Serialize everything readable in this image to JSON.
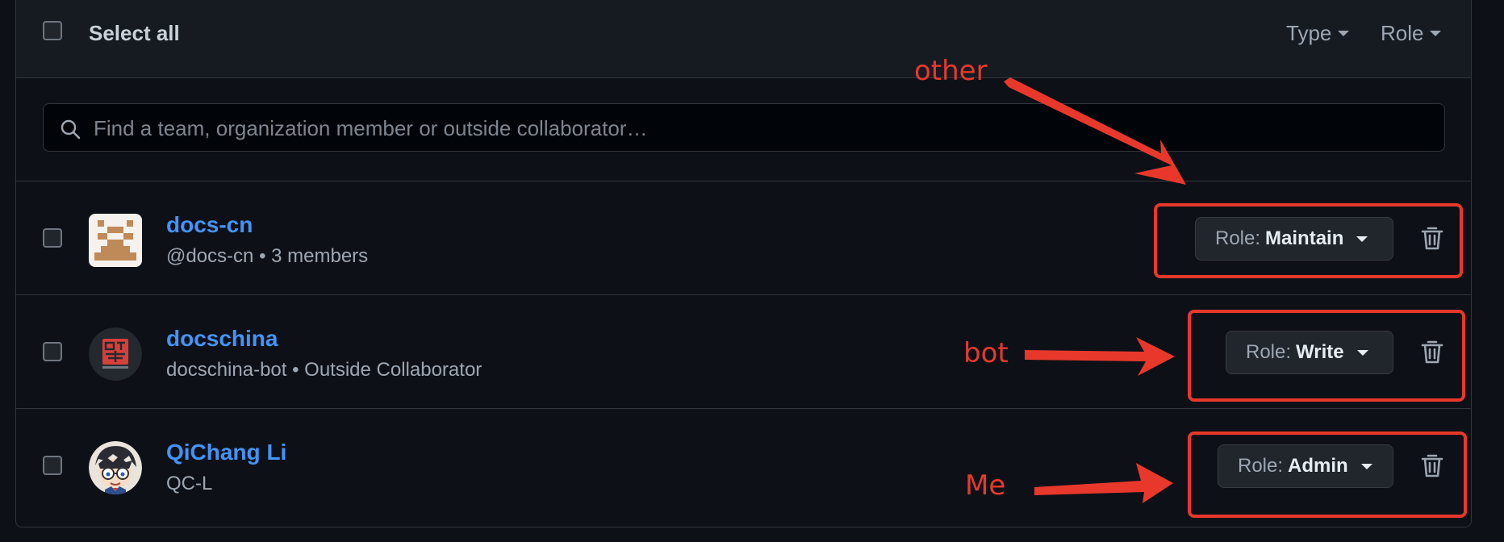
{
  "header": {
    "select_all_label": "Select all",
    "type_filter_label": "Type",
    "role_filter_label": "Role"
  },
  "search": {
    "placeholder": "Find a team, organization member or outside collaborator…",
    "value": ""
  },
  "members": [
    {
      "name": "docs-cn",
      "subtitle": "@docs-cn • 3 members",
      "avatar": "team-avatar-icon",
      "role_prefix": "Role:",
      "role": "Maintain",
      "annotation": "other"
    },
    {
      "name": "docschina",
      "subtitle": "docschina-bot • Outside Collaborator",
      "avatar": "docschina-logo",
      "role_prefix": "Role:",
      "role": "Write",
      "annotation": "bot"
    },
    {
      "name": "QiChang Li",
      "subtitle": "QC-L",
      "avatar": "user-avatar",
      "role_prefix": "Role:",
      "role": "Admin",
      "annotation": "Me"
    }
  ],
  "colors": {
    "background": "#0d1117",
    "header_bg": "#161b22",
    "border": "#30363d",
    "link": "#4493f8",
    "muted": "#9da7b3",
    "annotation": "#e8382c"
  },
  "icons": [
    "search-icon",
    "caret-down-icon",
    "trash-icon"
  ]
}
